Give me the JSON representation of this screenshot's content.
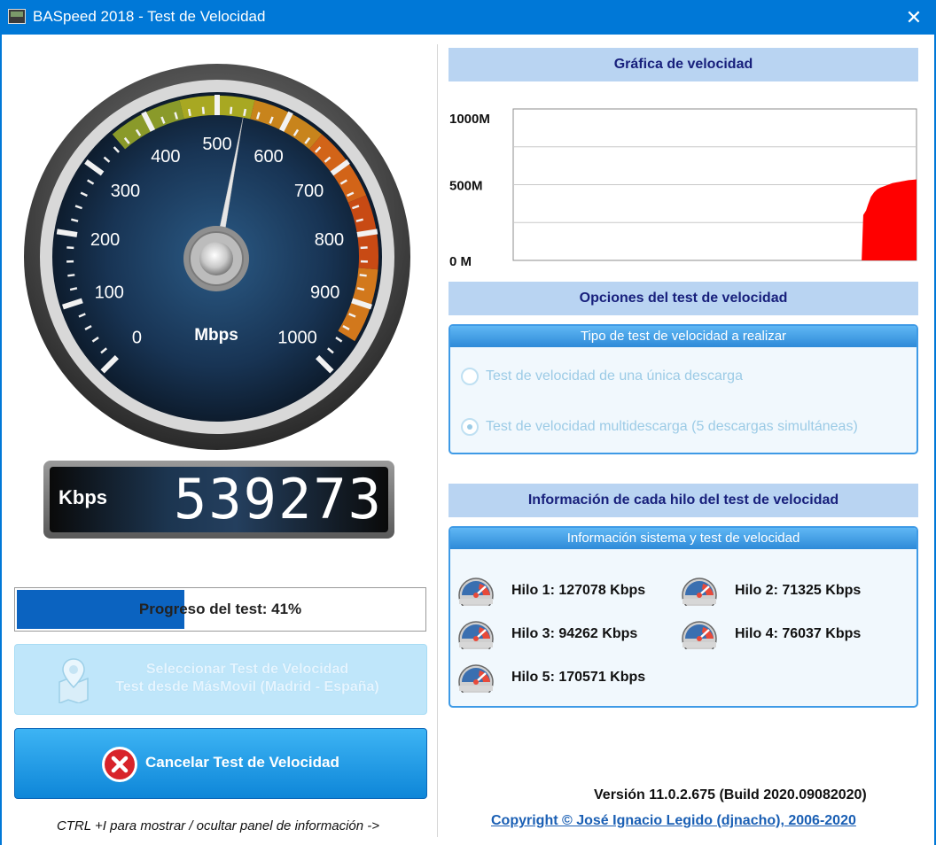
{
  "window": {
    "title": "BASpeed 2018 - Test de Velocidad",
    "close_glyph": "✕"
  },
  "gauge": {
    "ticks": [
      "0",
      "100",
      "200",
      "300",
      "400",
      "500",
      "600",
      "700",
      "800",
      "900",
      "1000"
    ],
    "unit": "Mbps",
    "max": 1000,
    "needle_value": 539
  },
  "display": {
    "unit": "Kbps",
    "value": "539273"
  },
  "progress": {
    "label": "Progreso del test: 41%",
    "percent": 41
  },
  "buttons": {
    "select_line1": "Seleccionar Test de Velocidad",
    "select_line2": "Test desde MásMovil (Madrid - España)",
    "cancel": "Cancelar Test de Velocidad"
  },
  "hint": "CTRL +I para mostrar / ocultar panel de información ->",
  "speed_chart": {
    "header": "Gráfica de velocidad",
    "y_labels": [
      "1000M",
      "500M",
      "0 M"
    ]
  },
  "chart_data": {
    "type": "area",
    "title": "Gráfica de velocidad",
    "ylim": [
      0,
      1000
    ],
    "y_tick_labels": [
      "1000M",
      "500M",
      "0 M"
    ],
    "y_ticks": [
      1000,
      500,
      0
    ],
    "x_range": [
      0,
      100
    ],
    "color": "#ff0000",
    "x": [
      86.4,
      86.8,
      87.5,
      88,
      88.7,
      89.5,
      90.3,
      91,
      92,
      93,
      94,
      95,
      96,
      97,
      98,
      99,
      100
    ],
    "values": [
      0,
      300,
      330,
      370,
      420,
      450,
      470,
      480,
      490,
      500,
      510,
      515,
      520,
      525,
      530,
      532,
      535
    ]
  },
  "options": {
    "header": "Opciones del test de velocidad",
    "panel_title": "Tipo de test de velocidad a realizar",
    "radio1": "Test de velocidad de una única descarga",
    "radio2": "Test de velocidad multidescarga (5 descargas simultáneas)"
  },
  "info": {
    "header": "Información de cada hilo del test de velocidad",
    "panel_title": "Información sistema y test de velocidad",
    "threads": [
      "Hilo 1: 127078 Kbps",
      "Hilo 2: 71325 Kbps",
      "Hilo 3: 94262 Kbps",
      "Hilo 4: 76037 Kbps",
      "Hilo 5: 170571 Kbps"
    ]
  },
  "footer": {
    "version": "Versión 11.0.2.675 (Build 2020.09082020)",
    "copyright": "Copyright © José Ignacio Legido (djnacho), 2006-2020"
  }
}
